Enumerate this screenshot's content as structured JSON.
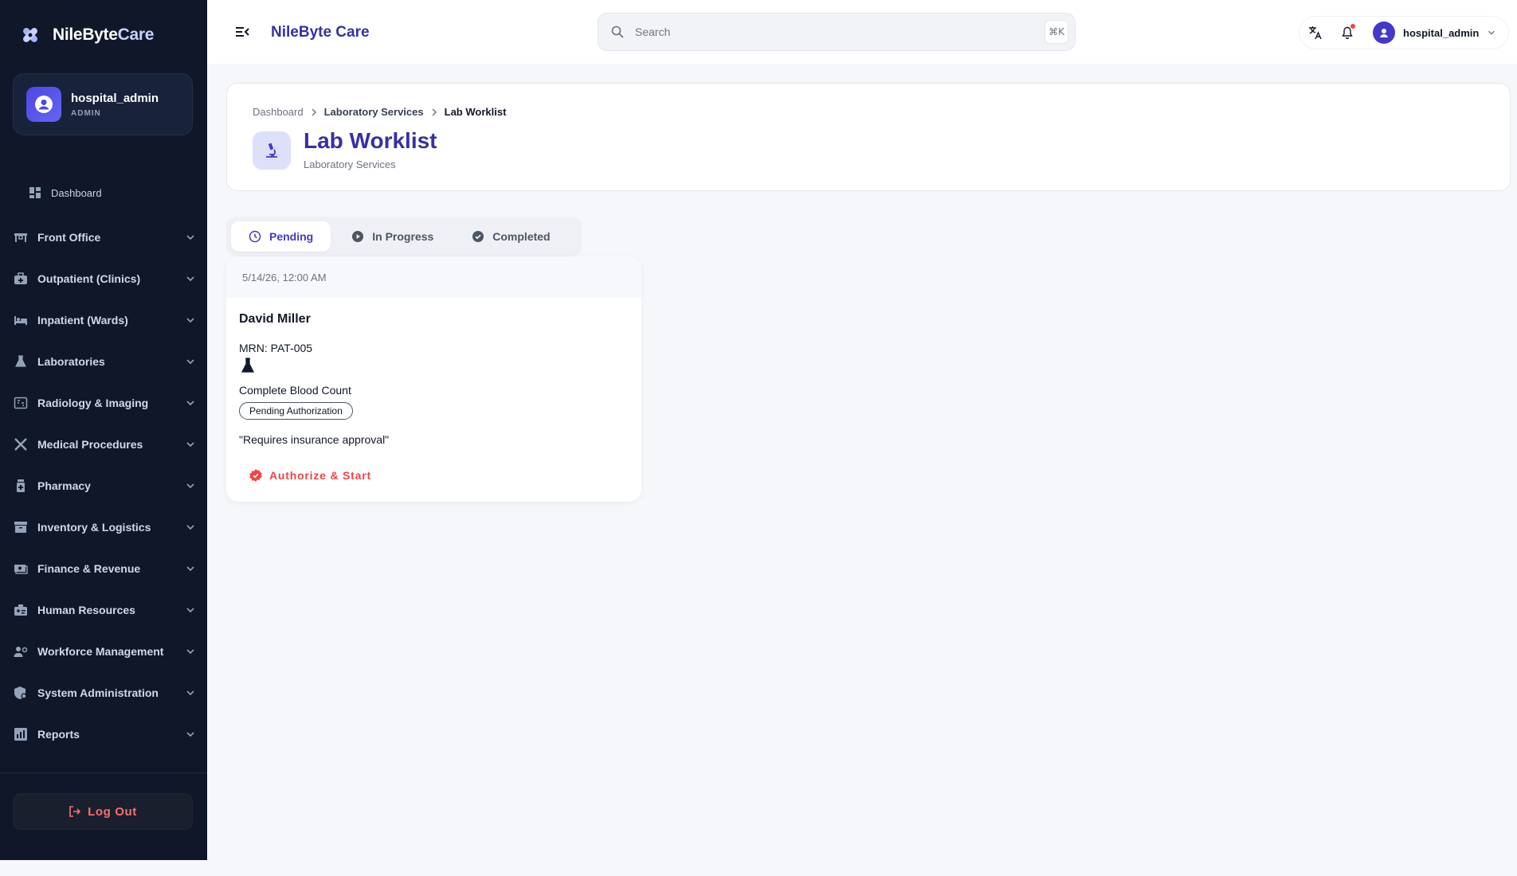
{
  "brand": {
    "name_primary": "NileByte",
    "name_accent": "Care"
  },
  "user": {
    "name": "hospital_admin",
    "role": "ADMIN"
  },
  "sidebar": {
    "dashboard": "Dashboard",
    "items": [
      {
        "label": "Front Office",
        "icon": "front-desk-icon"
      },
      {
        "label": "Outpatient (Clinics)",
        "icon": "medical-bag-icon"
      },
      {
        "label": "Inpatient (Wards)",
        "icon": "bed-icon"
      },
      {
        "label": "Laboratories",
        "icon": "flask-icon"
      },
      {
        "label": "Radiology & Imaging",
        "icon": "scan-icon"
      },
      {
        "label": "Medical Procedures",
        "icon": "tools-icon"
      },
      {
        "label": "Pharmacy",
        "icon": "medicine-bottle-icon"
      },
      {
        "label": "Inventory & Logistics",
        "icon": "archive-icon"
      },
      {
        "label": "Finance & Revenue",
        "icon": "money-icon"
      },
      {
        "label": "Human Resources",
        "icon": "badge-icon"
      },
      {
        "label": "Workforce Management",
        "icon": "people-gear-icon"
      },
      {
        "label": "System Administration",
        "icon": "shield-gear-icon"
      },
      {
        "label": "Reports",
        "icon": "chart-icon"
      }
    ],
    "logout": "Log Out"
  },
  "topbar": {
    "title": "NileByte Care",
    "search_placeholder": "Search",
    "shortcut": "⌘K",
    "user_name": "hospital_admin"
  },
  "header": {
    "breadcrumb": [
      "Dashboard",
      "Laboratory Services",
      "Lab Worklist"
    ],
    "title": "Lab Worklist",
    "subtitle": "Laboratory Services"
  },
  "tabs": [
    {
      "label": "Pending",
      "active": true
    },
    {
      "label": "In Progress",
      "active": false
    },
    {
      "label": "Completed",
      "active": false
    }
  ],
  "worklist": [
    {
      "date": "5/14/26, 12:00 AM",
      "patient": "David Miller",
      "mrn": "MRN: PAT-005",
      "test": "Complete Blood Count",
      "status": "Pending Authorization",
      "note": "\"Requires insurance approval\"",
      "action": "Authorize & Start"
    }
  ],
  "colors": {
    "sidebar_bg": "#0f1729",
    "brand": "#3730a3",
    "danger": "#ef4444"
  }
}
